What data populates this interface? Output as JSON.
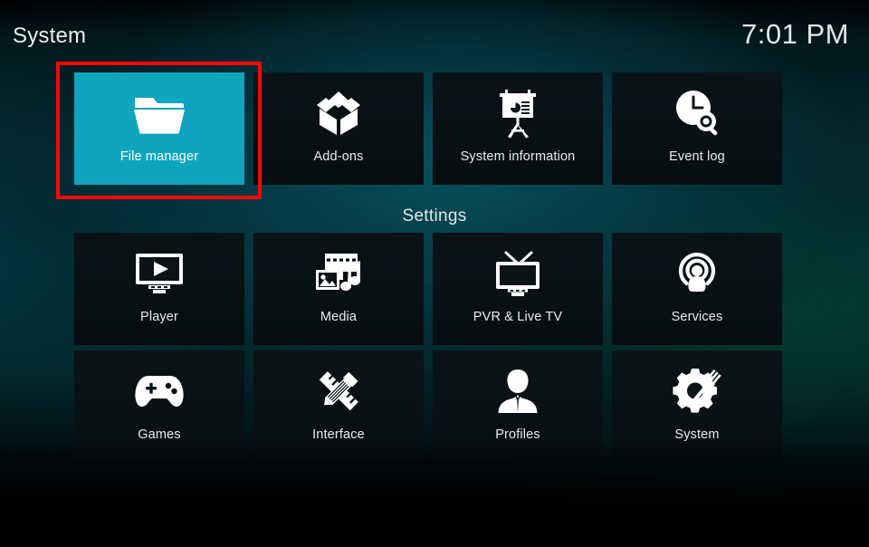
{
  "header": {
    "title": "System",
    "clock": "7:01 PM"
  },
  "sections": {
    "settings_label": "Settings"
  },
  "colors": {
    "selected_tile": "#0fa5bf",
    "tile_background": "#0a1417",
    "highlight_border": "#f00a0a",
    "text": "#e7eef0"
  },
  "top_row": [
    {
      "label": "File manager",
      "icon": "folder-icon",
      "selected": true
    },
    {
      "label": "Add-ons",
      "icon": "open-box-icon",
      "selected": false
    },
    {
      "label": "System information",
      "icon": "presentation-chart-icon",
      "selected": false
    },
    {
      "label": "Event log",
      "icon": "clock-search-icon",
      "selected": false
    }
  ],
  "settings_rows": [
    [
      {
        "label": "Player",
        "icon": "monitor-play-icon",
        "selected": false
      },
      {
        "label": "Media",
        "icon": "film-photo-music-icon",
        "selected": false
      },
      {
        "label": "PVR & Live TV",
        "icon": "tv-antenna-icon",
        "selected": false
      },
      {
        "label": "Services",
        "icon": "broadcast-person-icon",
        "selected": false
      }
    ],
    [
      {
        "label": "Games",
        "icon": "gamepad-icon",
        "selected": false
      },
      {
        "label": "Interface",
        "icon": "pencil-ruler-icon",
        "selected": false
      },
      {
        "label": "Profiles",
        "icon": "person-bust-icon",
        "selected": false
      },
      {
        "label": "System",
        "icon": "gears-wrench-icon",
        "selected": false
      }
    ]
  ],
  "annotation": {
    "highlighted_item": "File manager"
  }
}
